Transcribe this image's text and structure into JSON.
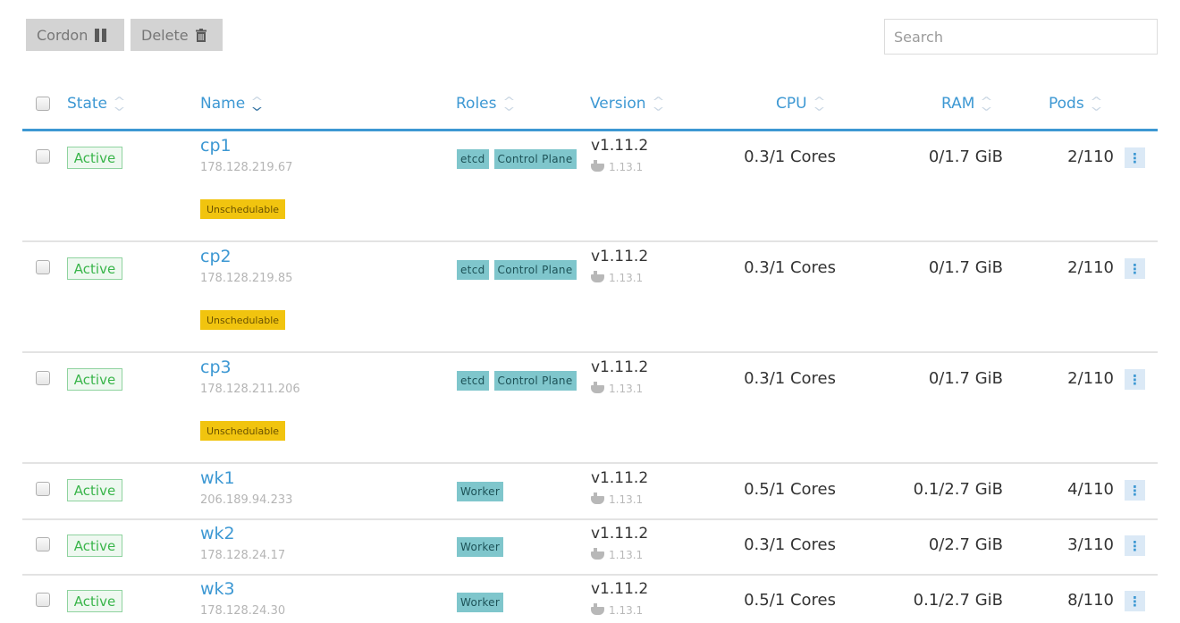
{
  "toolbar": {
    "cordon_label": "Cordon",
    "delete_label": "Delete"
  },
  "search": {
    "placeholder": "Search"
  },
  "table": {
    "headers": {
      "state": "State",
      "name": "Name",
      "roles": "Roles",
      "version": "Version",
      "cpu": "CPU",
      "ram": "RAM",
      "pods": "Pods"
    },
    "rows": [
      {
        "state": "Active",
        "name": "cp1",
        "ip": "178.128.219.67",
        "badge": "Unschedulable",
        "roles": [
          "etcd",
          "Control Plane"
        ],
        "version": "v1.11.2",
        "docker": "1.13.1",
        "cpu": "0.3/1 Cores",
        "ram": "0/1.7 GiB",
        "pods": "2/110"
      },
      {
        "state": "Active",
        "name": "cp2",
        "ip": "178.128.219.85",
        "badge": "Unschedulable",
        "roles": [
          "etcd",
          "Control Plane"
        ],
        "version": "v1.11.2",
        "docker": "1.13.1",
        "cpu": "0.3/1 Cores",
        "ram": "0/1.7 GiB",
        "pods": "2/110"
      },
      {
        "state": "Active",
        "name": "cp3",
        "ip": "178.128.211.206",
        "badge": "Unschedulable",
        "roles": [
          "etcd",
          "Control Plane"
        ],
        "version": "v1.11.2",
        "docker": "1.13.1",
        "cpu": "0.3/1 Cores",
        "ram": "0/1.7 GiB",
        "pods": "2/110"
      },
      {
        "state": "Active",
        "name": "wk1",
        "ip": "206.189.94.233",
        "badge": "",
        "roles": [
          "Worker"
        ],
        "version": "v1.11.2",
        "docker": "1.13.1",
        "cpu": "0.5/1 Cores",
        "ram": "0.1/2.7 GiB",
        "pods": "4/110"
      },
      {
        "state": "Active",
        "name": "wk2",
        "ip": "178.128.24.17",
        "badge": "",
        "roles": [
          "Worker"
        ],
        "version": "v1.11.2",
        "docker": "1.13.1",
        "cpu": "0.3/1 Cores",
        "ram": "0/2.7 GiB",
        "pods": "3/110"
      },
      {
        "state": "Active",
        "name": "wk3",
        "ip": "178.128.24.30",
        "badge": "",
        "roles": [
          "Worker"
        ],
        "version": "v1.11.2",
        "docker": "1.13.1",
        "cpu": "0.5/1 Cores",
        "ram": "0.1/2.7 GiB",
        "pods": "8/110"
      }
    ]
  },
  "icons": {
    "cordon": "pause-icon",
    "delete": "trash-icon",
    "sort": "sort-icon",
    "docker": "docker-icon",
    "row_menu": "vertical-dots-icon"
  },
  "colors": {
    "accent": "#3d98d3",
    "active_green": "#39b54a",
    "unschedulable_yellow": "#f1c40f",
    "role_teal": "#7fc6cc"
  }
}
